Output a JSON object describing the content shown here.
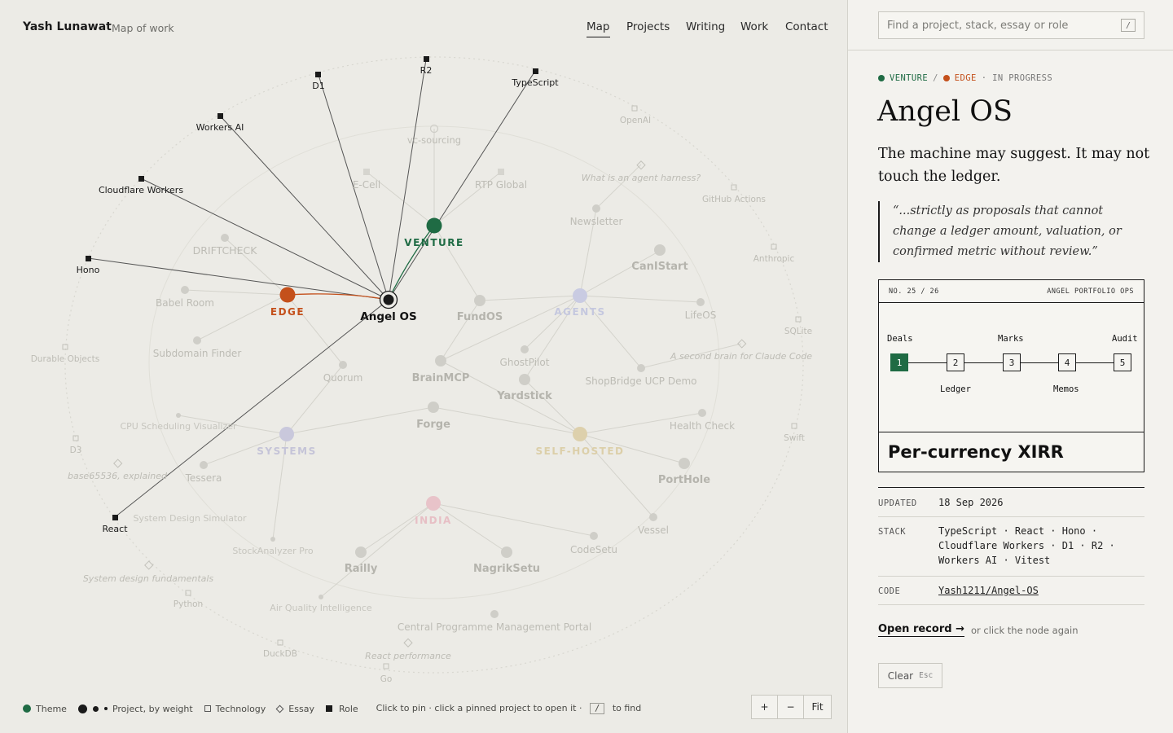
{
  "header": {
    "brand": "Yash Lunawat",
    "subtitle": "Map of work",
    "nav": [
      "Map",
      "Projects",
      "Writing",
      "Work",
      "Contact"
    ],
    "active_nav": "Map"
  },
  "graph": {
    "selected": "Angel OS",
    "themes": [
      {
        "id": "venture",
        "label": "VENTURE",
        "color": "#1f6b44",
        "active": true
      },
      {
        "id": "edge",
        "label": "EDGE",
        "color": "#c4501b",
        "active": true
      },
      {
        "id": "agents",
        "label": "AGENTS",
        "color": "#b9bcd8",
        "active": false
      },
      {
        "id": "systems",
        "label": "SYSTEMS",
        "color": "#bdbcd4",
        "active": false
      },
      {
        "id": "selfhosted",
        "label": "SELF-HOSTED",
        "color": "#d8cba4",
        "active": false
      },
      {
        "id": "india",
        "label": "INDIA",
        "color": "#e4bcc3",
        "active": false
      }
    ],
    "projects": [
      "Angel OS",
      "FundOS",
      "BrainMCP",
      "Forge",
      "CanIStart",
      "LifeOS",
      "Newsletter",
      "GhostPilot",
      "Yardstick",
      "ShopBridge UCP Demo",
      "Health Check",
      "PortHole",
      "Vessel",
      "CodeSetu",
      "NagrikSetu",
      "Railly",
      "Central Programme Management Portal",
      "Air Quality Intelligence",
      "StockAnalyzer Pro",
      "Tessera",
      "Quorum",
      "Subdomain Finder",
      "Babel Room",
      "DRIFTCHECK",
      "E-Cell",
      "RTP Global",
      "vc-sourcing",
      "CPU Scheduling Visualizer",
      "System Design Simulator"
    ],
    "technologies": [
      "D1",
      "R2",
      "TypeScript",
      "Workers AI",
      "Cloudflare Workers",
      "Hono",
      "React",
      "OpenAI",
      "GitHub Actions",
      "Anthropic",
      "SQLite",
      "Swift",
      "Durable Objects",
      "D3",
      "Python",
      "DuckDB",
      "Go"
    ],
    "essays": [
      "What is an agent harness?",
      "A second brain for Claude Code",
      "base65536, explained",
      "System design fundamentals",
      "React performance"
    ]
  },
  "legend": {
    "theme": "Theme",
    "project": "Project, by weight",
    "technology": "Technology",
    "essay": "Essay",
    "role": "Role",
    "hint_pre": "Click to pin · click a pinned project to open it ·",
    "hint_key": "/",
    "hint_post": "to find"
  },
  "zoom": {
    "in": "+",
    "out": "−",
    "fit": "Fit"
  },
  "panel": {
    "search_placeholder": "Find a project, stack, essay or role",
    "search_key": "/",
    "crumbs": {
      "theme1": "VENTURE",
      "sep": "/",
      "theme2": "EDGE",
      "status": "· IN PROGRESS",
      "color1": "#1f6b44",
      "color2": "#c4501b"
    },
    "title": "Angel OS",
    "tagline": "The machine may suggest. It may not touch the ledger.",
    "quote": "“...strictly as proposals that cannot change a ledger amount, valuation, or confirmed metric without review.”",
    "card": {
      "number": "NO. 25 / 26",
      "label": "ANGEL PORTFOLIO OPS",
      "steps": [
        {
          "n": "1",
          "label": "Deals",
          "pos": "top"
        },
        {
          "n": "2",
          "label": "Ledger",
          "pos": "bottom"
        },
        {
          "n": "3",
          "label": "Marks",
          "pos": "top"
        },
        {
          "n": "4",
          "label": "Memos",
          "pos": "bottom"
        },
        {
          "n": "5",
          "label": "Audit",
          "pos": "top"
        }
      ],
      "active_step": "1",
      "footer": "Per-currency XIRR"
    },
    "meta": {
      "updated_key": "UPDATED",
      "updated_val": "18 Sep 2026",
      "stack_key": "STACK",
      "stack_lines": [
        "TypeScript · React · Hono ·",
        "Cloudflare Workers · D1 · R2 ·",
        "Workers AI · Vitest"
      ],
      "code_key": "CODE",
      "code_val": "Yash1211/Angel-OS"
    },
    "open_record": "Open record →",
    "open_hint": "or click the node again",
    "clear": "Clear",
    "clear_key": "Esc"
  }
}
